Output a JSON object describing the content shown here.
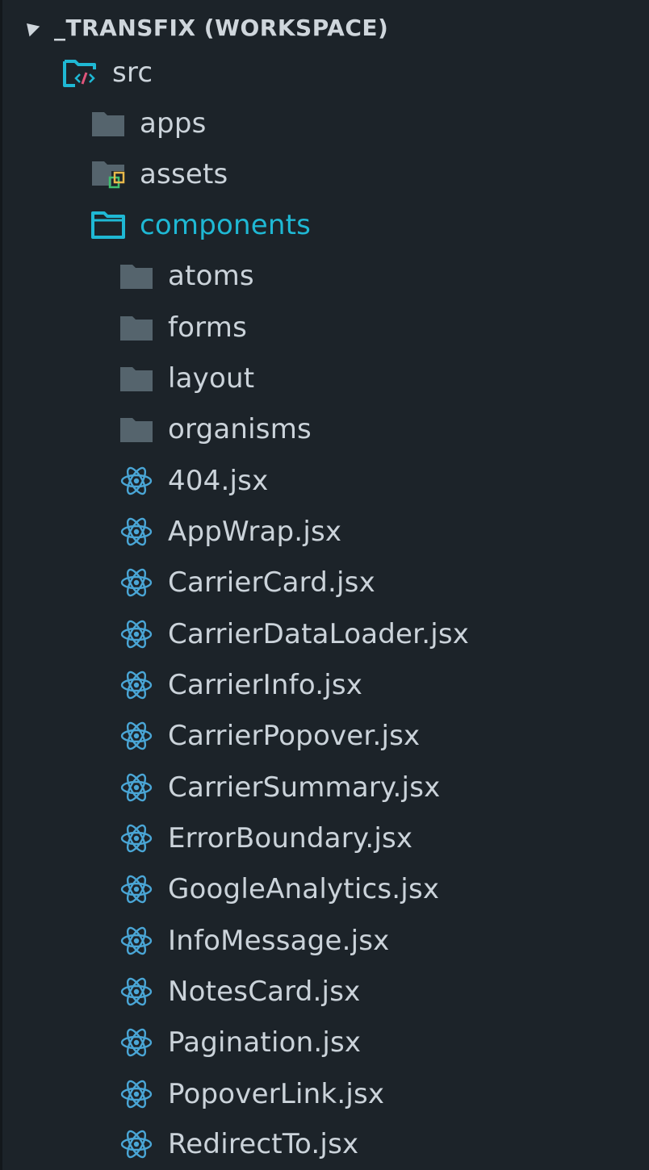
{
  "workspace": {
    "title": "_TRANSFIX (WORKSPACE)"
  },
  "colors": {
    "background": "#1c2329",
    "text": "#cbd3da",
    "accent": "#1fb8d4",
    "folder": "#55646d",
    "react": "#4aa6d6"
  },
  "tree": {
    "src": {
      "label": "src",
      "icon": "source-folder-open-icon"
    },
    "apps": {
      "label": "apps",
      "icon": "folder-icon"
    },
    "assets": {
      "label": "assets",
      "icon": "assets-folder-icon"
    },
    "components": {
      "label": "components",
      "icon": "folder-open-icon"
    },
    "subfolders": [
      {
        "label": "atoms",
        "icon": "folder-icon"
      },
      {
        "label": "forms",
        "icon": "folder-icon"
      },
      {
        "label": "layout",
        "icon": "folder-icon"
      },
      {
        "label": "organisms",
        "icon": "folder-icon"
      }
    ],
    "files": [
      {
        "label": "404.jsx",
        "icon": "react-icon"
      },
      {
        "label": "AppWrap.jsx",
        "icon": "react-icon"
      },
      {
        "label": "CarrierCard.jsx",
        "icon": "react-icon"
      },
      {
        "label": "CarrierDataLoader.jsx",
        "icon": "react-icon"
      },
      {
        "label": "CarrierInfo.jsx",
        "icon": "react-icon"
      },
      {
        "label": "CarrierPopover.jsx",
        "icon": "react-icon"
      },
      {
        "label": "CarrierSummary.jsx",
        "icon": "react-icon"
      },
      {
        "label": "ErrorBoundary.jsx",
        "icon": "react-icon"
      },
      {
        "label": "GoogleAnalytics.jsx",
        "icon": "react-icon"
      },
      {
        "label": "InfoMessage.jsx",
        "icon": "react-icon"
      },
      {
        "label": "NotesCard.jsx",
        "icon": "react-icon"
      },
      {
        "label": "Pagination.jsx",
        "icon": "react-icon"
      },
      {
        "label": "PopoverLink.jsx",
        "icon": "react-icon"
      },
      {
        "label": "RedirectTo.jsx",
        "icon": "react-icon"
      }
    ]
  }
}
